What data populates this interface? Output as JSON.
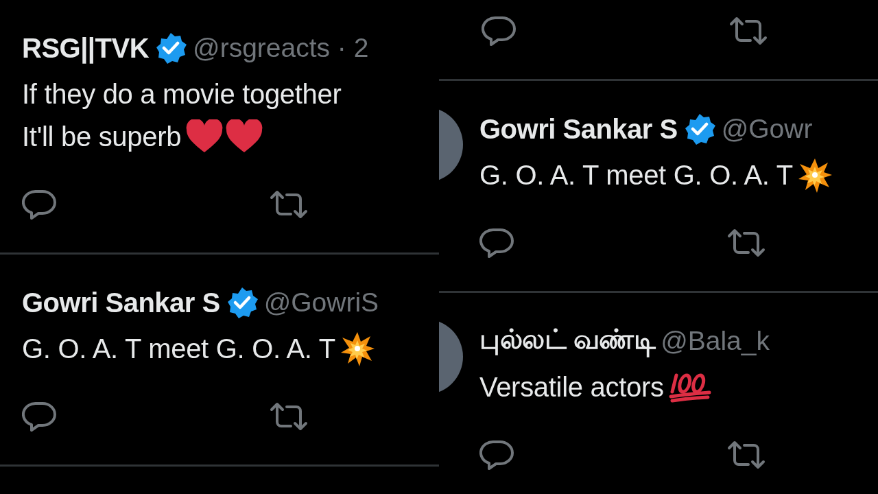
{
  "panels": [
    {
      "items": [
        {
          "kind": "tweet",
          "name": "RSG||TVK",
          "verified": true,
          "handle": "@rsgreacts · 2",
          "lines": [
            {
              "text": "If they do a movie together"
            },
            {
              "text": "It'll be superb",
              "emojis": [
                {
                  "kind": "heart"
                },
                {
                  "kind": "heart"
                }
              ]
            }
          ]
        },
        {
          "kind": "tweet",
          "name": "Gowri Sankar S",
          "verified": true,
          "handle": "@GowriS",
          "lines": [
            {
              "text": "G. O. A. T meet G. O. A. T",
              "emojis": [
                {
                  "kind": "burst"
                }
              ]
            }
          ]
        }
      ]
    },
    {
      "items": [
        {
          "kind": "actions"
        },
        {
          "kind": "tweet",
          "name": "Gowri Sankar S",
          "verified": true,
          "handle": "@Gowr",
          "lines": [
            {
              "text": "G. O. A. T meet G. O. A. T",
              "emojis": [
                {
                  "kind": "burst"
                }
              ]
            }
          ]
        },
        {
          "kind": "tweet",
          "name": "புல்லட் வண்டி",
          "verified": false,
          "handle": "@Bala_k",
          "lines": [
            {
              "text": "Versatile actors",
              "emojis": [
                {
                  "kind": "hundred"
                }
              ]
            }
          ]
        }
      ]
    }
  ]
}
